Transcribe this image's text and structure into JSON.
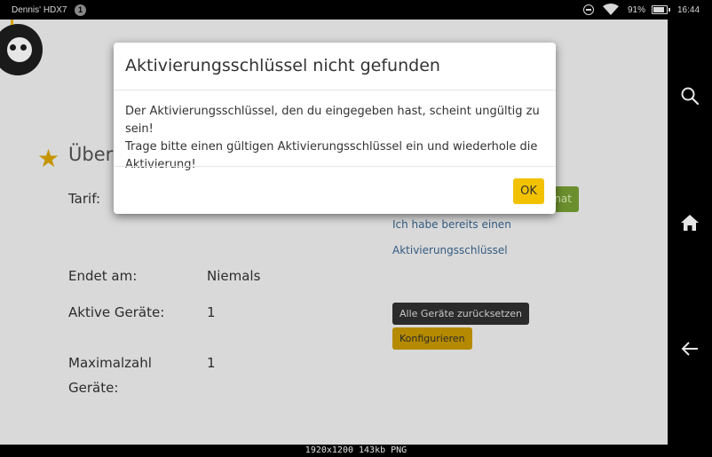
{
  "status_bar": {
    "device_name": "Dennis' HDX7",
    "notification_count": "1",
    "battery_percent": "91%",
    "time": "16:44",
    "icons": [
      "dnd-icon",
      "wifi-icon",
      "battery-icon"
    ]
  },
  "page": {
    "title": "Übers",
    "fields": [
      {
        "label": "Tarif:",
        "value": ""
      },
      {
        "label": "Endet am:",
        "value": "Niemals"
      },
      {
        "label": "Aktive Geräte:",
        "value": "1"
      },
      {
        "label": "Maximalzahl",
        "label2": "Geräte:",
        "value": "1"
      }
    ],
    "green_button_label": "nat",
    "links": [
      "Ich habe bereits einen",
      "Aktivierungsschlüssel"
    ],
    "reset_devices_label": "Alle Geräte zurücksetzen",
    "configure_label": "Konfigurieren"
  },
  "modal": {
    "title": "Aktivierungsschlüssel nicht gefunden",
    "body_lines": [
      "Der Aktivierungsschlüssel, den du eingegeben hast, scheint ungültig zu sein!",
      "Trage bitte einen gültigen Aktivierungsschlüssel ein und wiederhole die",
      "Aktivierung!"
    ],
    "ok_label": "OK"
  },
  "nav_bar": {
    "icons": [
      "search-icon",
      "home-icon",
      "back-arrow-icon"
    ]
  },
  "caption": "1920x1200  143kb  PNG",
  "colors": {
    "ok_button": "#f2c200",
    "background_dim": "#d9d9d9",
    "link": "#345b80",
    "configure_button": "#b58a00",
    "green_button": "#6c8f2e"
  }
}
